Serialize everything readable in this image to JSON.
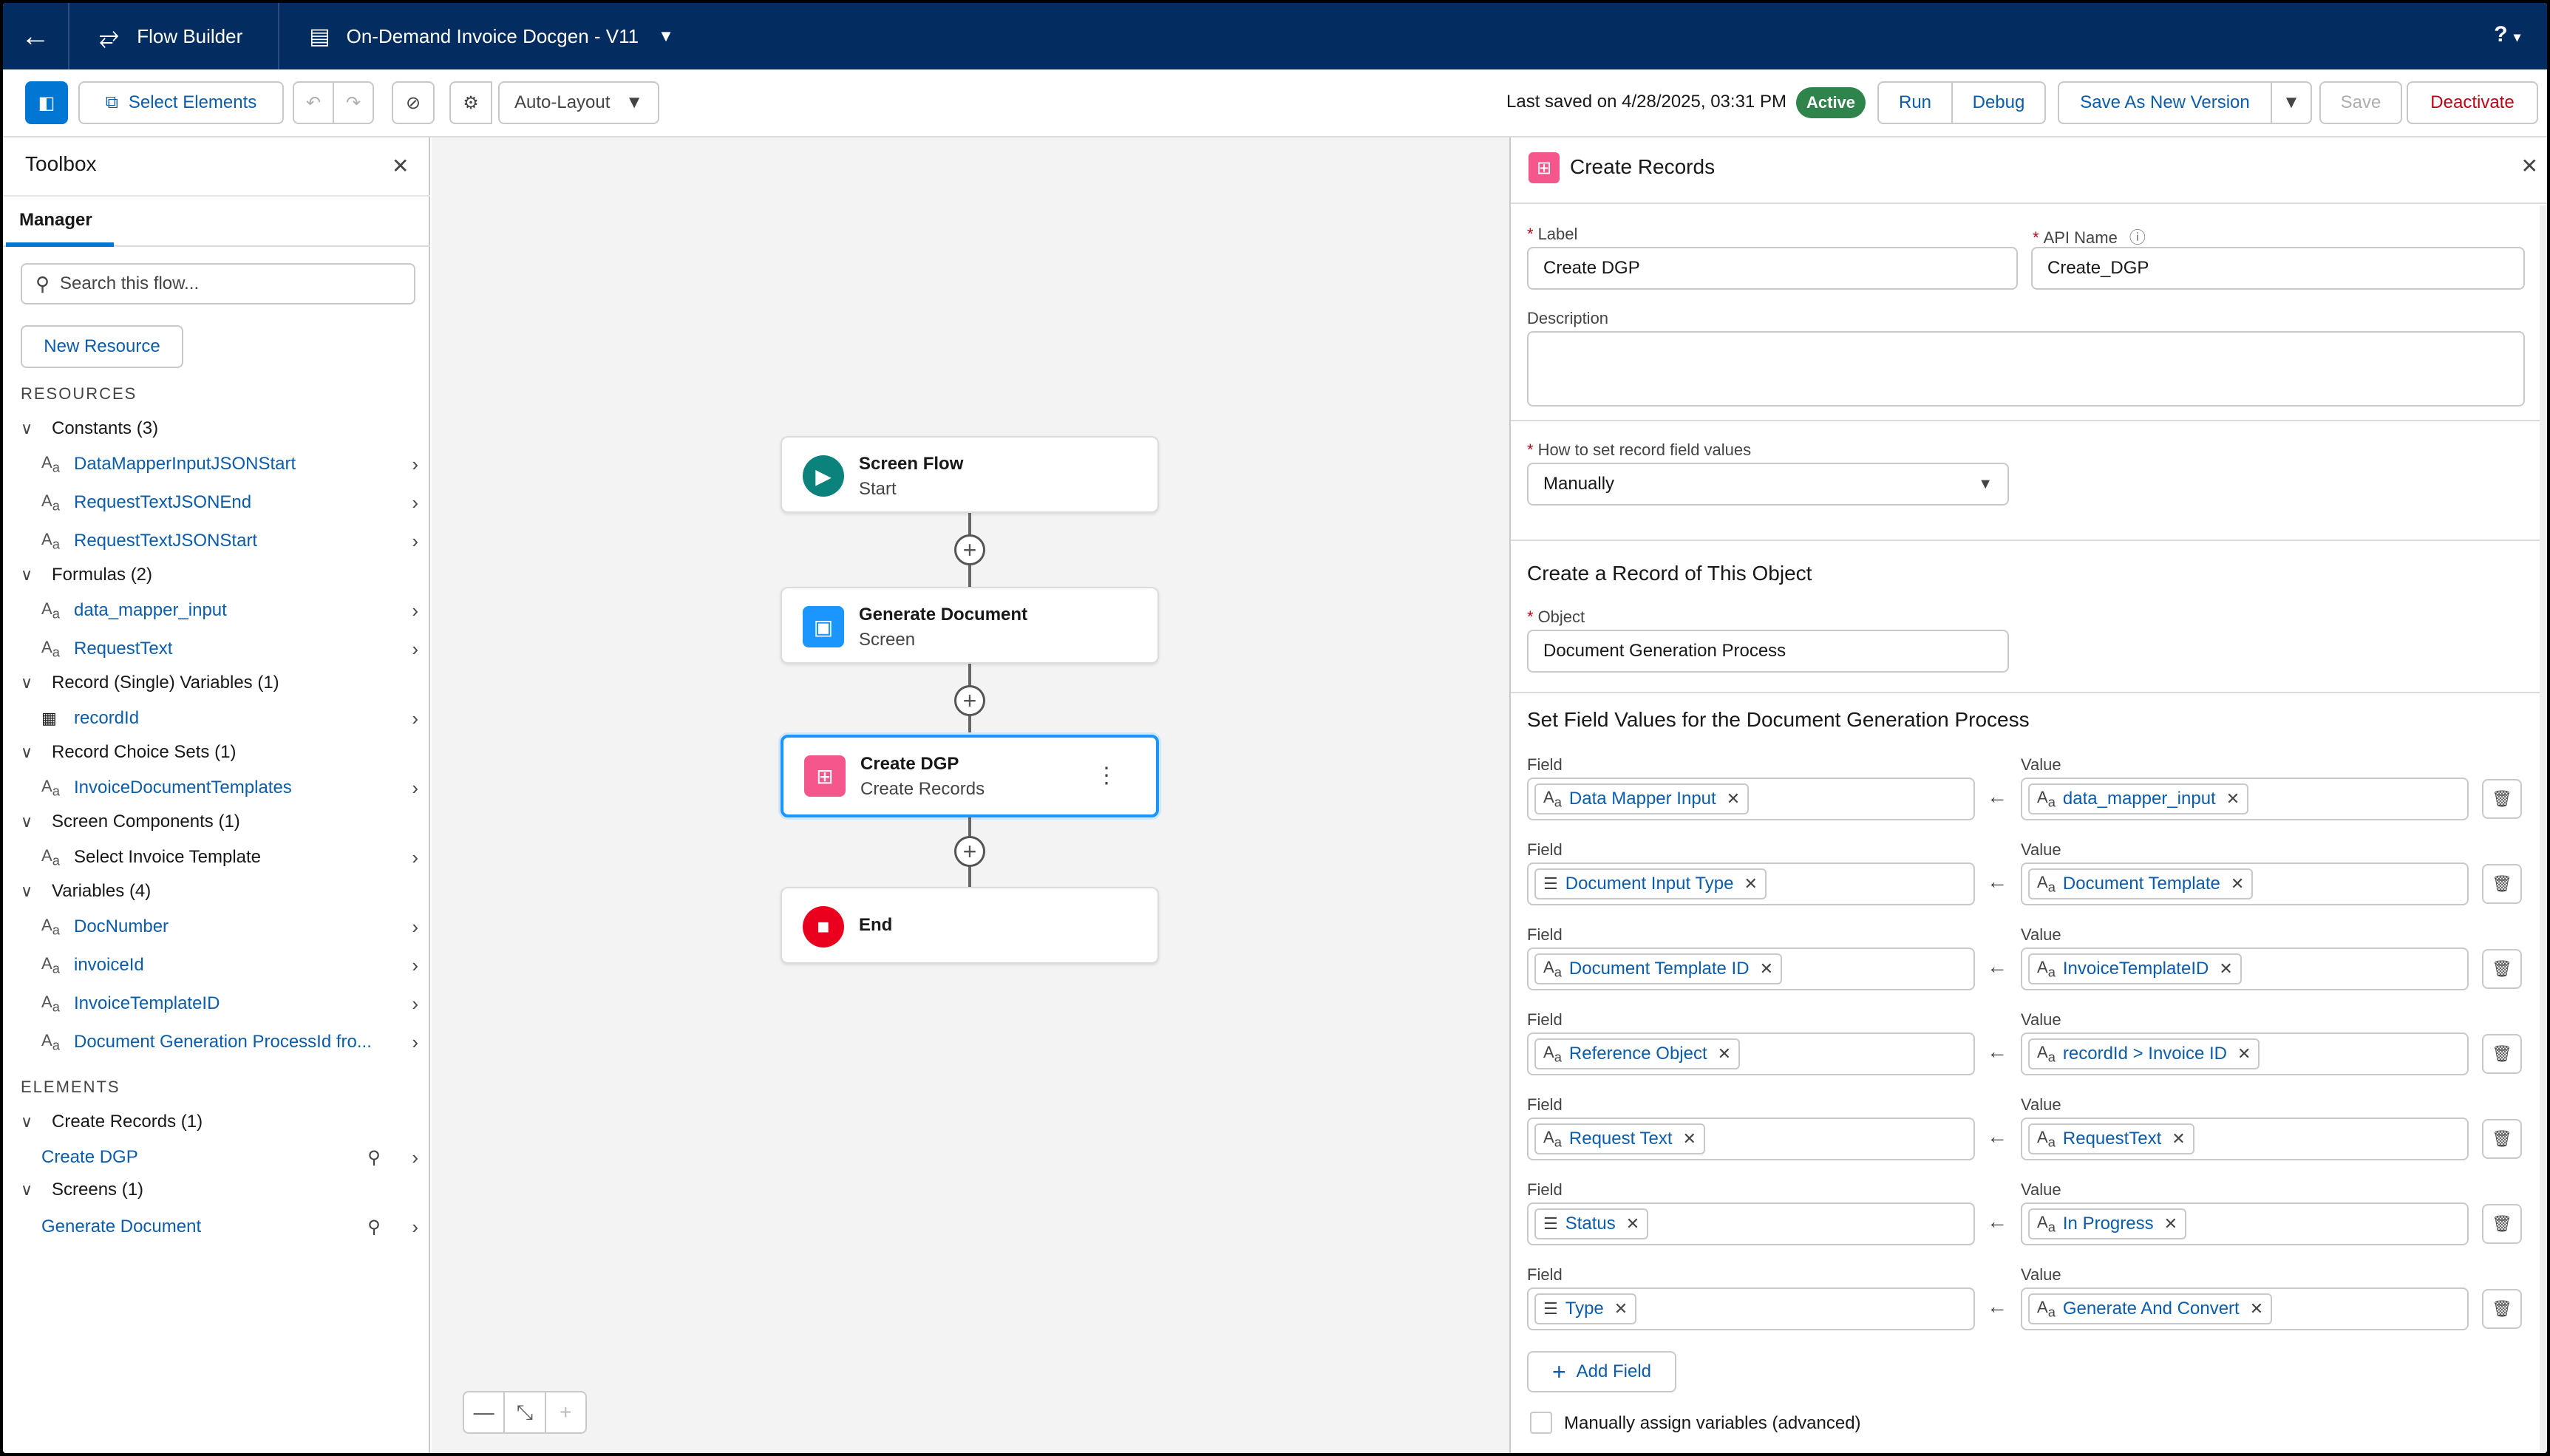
{
  "header": {
    "back_icon": "back-arrow-icon",
    "app_name": "Flow Builder",
    "flow_name": "On-Demand Invoice Docgen - V11",
    "help": "?"
  },
  "toolbar": {
    "select_elements": "Select Elements",
    "layout": "Auto-Layout",
    "last_saved": "Last saved on 4/28/2025, 03:31 PM",
    "status": "Active",
    "run": "Run",
    "debug": "Debug",
    "save_as_new": "Save As New Version",
    "save": "Save",
    "deactivate": "Deactivate"
  },
  "toolbox": {
    "title": "Toolbox",
    "tab": "Manager",
    "search_placeholder": "Search this flow...",
    "new_resource": "New Resource",
    "resources_heading": "RESOURCES",
    "elements_heading": "ELEMENTS",
    "groups": [
      {
        "label": "Constants (3)",
        "items": [
          "DataMapperInputJSONStart",
          "RequestTextJSONEnd",
          "RequestTextJSONStart"
        ]
      },
      {
        "label": "Formulas (2)",
        "items": [
          "data_mapper_input",
          "RequestText"
        ]
      },
      {
        "label": "Record (Single) Variables (1)",
        "items": [
          "recordId"
        ]
      },
      {
        "label": "Record Choice Sets (1)",
        "items": [
          "InvoiceDocumentTemplates"
        ]
      },
      {
        "label": "Screen Components (1)",
        "items": [
          "Select Invoice Template"
        ]
      },
      {
        "label": "Variables (4)",
        "items": [
          "DocNumber",
          "invoiceId",
          "InvoiceTemplateID",
          "Document Generation ProcessId fro..."
        ]
      }
    ],
    "element_groups": [
      {
        "label": "Create Records (1)",
        "items": [
          "Create DGP"
        ]
      },
      {
        "label": "Screens (1)",
        "items": [
          "Generate Document"
        ]
      }
    ]
  },
  "canvas": {
    "nodes": [
      {
        "title": "Screen Flow",
        "subtitle": "Start"
      },
      {
        "title": "Generate Document",
        "subtitle": "Screen"
      },
      {
        "title": "Create DGP",
        "subtitle": "Create Records"
      },
      {
        "title": "End",
        "subtitle": ""
      }
    ]
  },
  "panel": {
    "title": "Create Records",
    "label_label": "Label",
    "label_value": "Create DGP",
    "api_label": "API Name",
    "api_value": "Create_DGP",
    "description_label": "Description",
    "how_label": "How to set record field values",
    "how_value": "Manually",
    "create_heading": "Create a Record of This Object",
    "object_label": "Object",
    "object_value": "Document Generation Process",
    "set_heading": "Set Field Values for the Document Generation Process",
    "field_label": "Field",
    "value_label": "Value",
    "rows": [
      {
        "field": "Data Mapper Input",
        "value": "data_mapper_input"
      },
      {
        "field": "Document Input Type",
        "value": "Document Template"
      },
      {
        "field": "Document Template ID",
        "value": "InvoiceTemplateID"
      },
      {
        "field": "Reference Object",
        "value": "recordId > Invoice ID"
      },
      {
        "field": "Request Text",
        "value": "RequestText"
      },
      {
        "field": "Status",
        "value": "In Progress"
      },
      {
        "field": "Type",
        "value": "Generate And Convert"
      }
    ],
    "add_field": "Add Field",
    "manual_assign": "Manually assign variables (advanced)"
  },
  "colors": {
    "header_bg": "#032d60",
    "brand": "#0176d3",
    "active": "#2e844a",
    "create_records": "#f5578c",
    "start": "#0b827c",
    "screen": "#1b96ff",
    "end": "#ea001e"
  }
}
